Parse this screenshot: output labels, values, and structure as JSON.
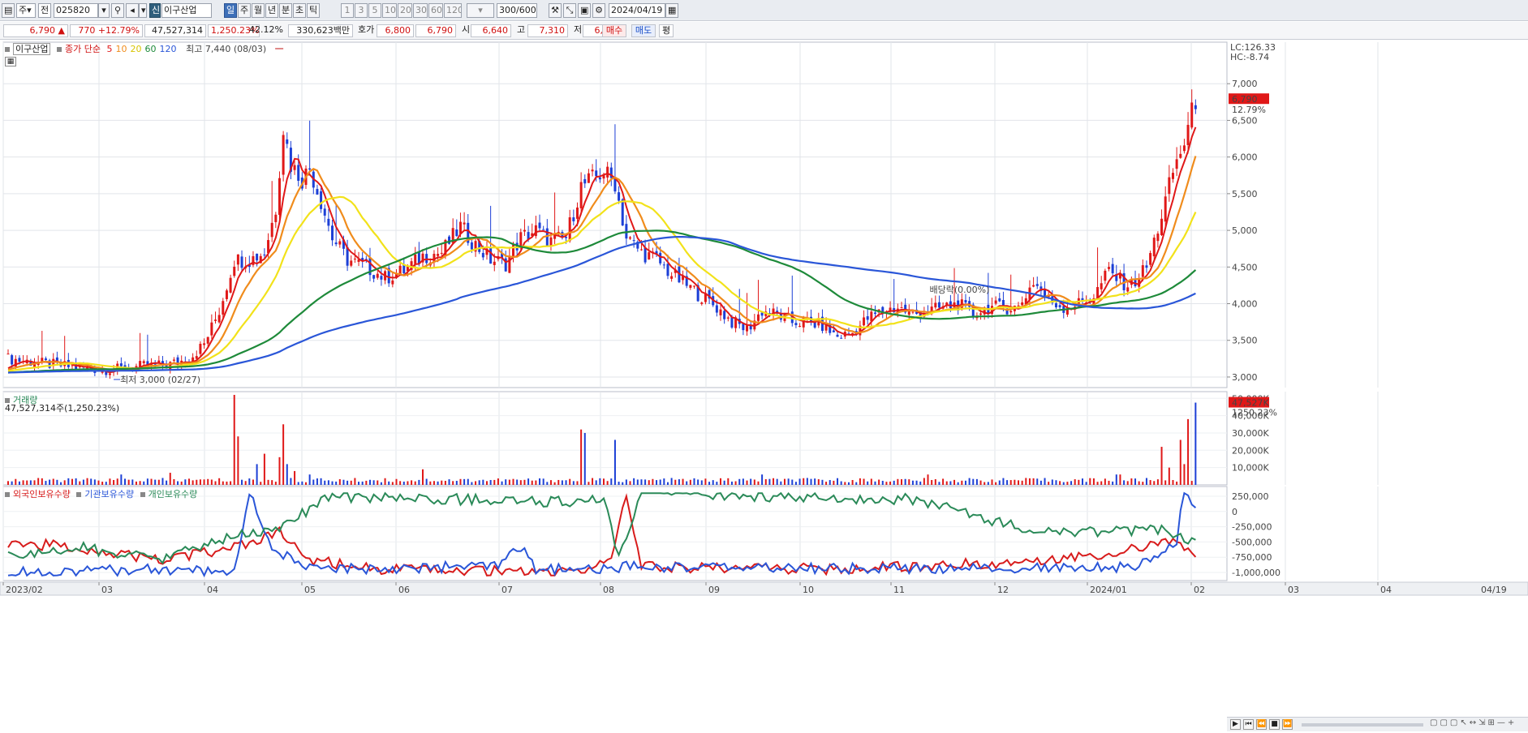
{
  "toolbar": {
    "period_d": "주",
    "mode": "전",
    "code": "025820",
    "stock_badge": "신",
    "stock_name": "이구산업",
    "tf": [
      "일",
      "주",
      "월",
      "년",
      "분",
      "초",
      "틱"
    ],
    "active_tf": "일",
    "minutes": [
      "1",
      "3",
      "5",
      "10",
      "20",
      "30",
      "60",
      "120"
    ],
    "count": "300/600",
    "date": "2024/04/19"
  },
  "quote": {
    "price": "6,790",
    "arrow": "▲",
    "change": "770",
    "change_pct": "+12.79%",
    "volume": "47,527,314",
    "vol_ratio": "1,250.23%",
    "turnover": "42.12%",
    "amount": "330,623백만",
    "ask_label": "호가",
    "ask1": "6,800",
    "ask2": "6,790",
    "open_label": "시",
    "open": "6,640",
    "high_label": "고",
    "high": "7,310",
    "low_label": "저",
    "low": "6,410",
    "buy": "매수",
    "sell": "매도",
    "avg": "평"
  },
  "price_panel": {
    "title": "이구산업",
    "ma_label": "종가 단순",
    "ma_periods": [
      "5",
      "10",
      "20",
      "60",
      "120"
    ],
    "ma_colors": [
      "#e01818",
      "#f08c1c",
      "#f2e21a",
      "#1e8a3a",
      "#2a56d8"
    ],
    "lc": "LC:126.33",
    "hc": "HC:-8.74",
    "last_price": "6,790",
    "last_pct": "12.79%",
    "y_ticks": [
      "7,000",
      "6,500",
      "6,000",
      "5,500",
      "5,000",
      "4,500",
      "4,000",
      "3,500",
      "3,000"
    ],
    "high_note": "최고 7,440 (08/03)",
    "low_note": "최저 3,000 (02/27)",
    "dividend_note": "배당락(0.00%)"
  },
  "volume_panel": {
    "title": "거래량",
    "summary": "47,527,314주(1,250.23%)",
    "last_label": "47,527K",
    "last_pct": "1250.23%",
    "y_ticks": [
      "50,000K",
      "40,000K",
      "30,000K",
      "20,000K",
      "10,000K"
    ]
  },
  "holdings_panel": {
    "series_names": [
      "외국인보유수량",
      "기관보유수량",
      "개인보유수량"
    ],
    "series_colors": [
      "#d81c1c",
      "#2a56d8",
      "#2a8a58"
    ],
    "y_ticks": [
      "250,000",
      "0",
      "-250,000",
      "-500,000",
      "-750,000",
      "-1,000,000"
    ]
  },
  "x_axis": {
    "labels": [
      "2023/02",
      "03",
      "04",
      "05",
      "06",
      "07",
      "08",
      "09",
      "10",
      "11",
      "12",
      "2024/01",
      "02",
      "03",
      "04",
      "04/19"
    ]
  },
  "scroll_icons": [
    "▶",
    "⏮",
    "⏪",
    "■",
    "⏩"
  ]
}
